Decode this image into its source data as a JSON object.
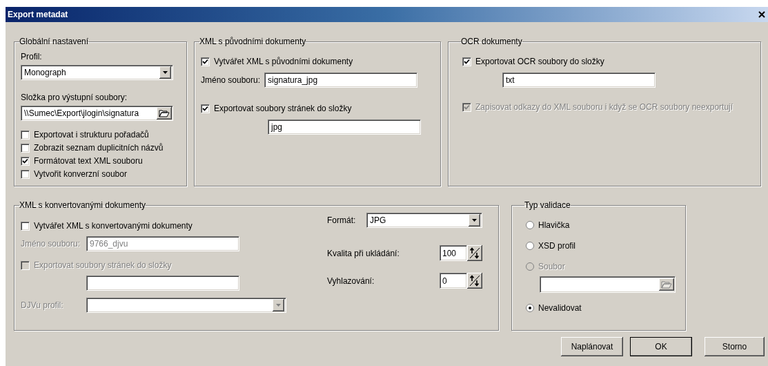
{
  "window": {
    "title": "Export metadat"
  },
  "global_settings": {
    "title": "Globální nastavení",
    "profile_label": "Profil:",
    "profile": {
      "value": "Monograph"
    },
    "folder_label": "Složka pro výstupní soubory:",
    "folder": {
      "value": "\\\\Sumec\\Export\\jlogin\\signatura"
    },
    "options": [
      {
        "label": "Exportovat i strukturu pořadačů",
        "checked": false
      },
      {
        "label": "Zobrazit seznam duplicitních názvů",
        "checked": false
      },
      {
        "label": "Formátovat text XML souboru",
        "checked": true
      },
      {
        "label": "Vytvořit konverzní soubor",
        "checked": false
      }
    ]
  },
  "original_xml": {
    "title": "XML s původními dokumenty",
    "create": {
      "label": "Vytvářet XML s původními dokumenty",
      "checked": true
    },
    "filename_label": "Jméno souboru:",
    "filename": {
      "value": "signatura_jpg"
    },
    "export_pages": {
      "label": "Exportovat soubory stránek do složky",
      "checked": true
    },
    "pages_folder": {
      "value": "jpg"
    }
  },
  "ocr": {
    "title": "OCR dokumenty",
    "export": {
      "label": "Exportovat OCR soubory do složky",
      "checked": true
    },
    "folder": {
      "value": "txt"
    },
    "write_links": {
      "label": "Zapisovat odkazy do XML souboru i když se OCR soubory neexportují",
      "checked": true,
      "disabled": true
    }
  },
  "converted_xml": {
    "title": "XML s konvertovanými dokumenty",
    "create": {
      "label": "Vytvářet XML s konvertovanými dokumenty",
      "checked": false
    },
    "filename_label": "Jméno souboru:",
    "filename": {
      "value": "9766_djvu",
      "disabled": true
    },
    "export_pages": {
      "label": "Exportovat soubory stránek do složky",
      "checked": false,
      "disabled": true
    },
    "djvu_label": "DJVu profil:",
    "djvu_profile": {
      "disabled": true
    },
    "format_label": "Formát:",
    "format": {
      "value": "JPG"
    },
    "quality_label": "Kvalita při ukládání:",
    "quality": {
      "value": "100"
    },
    "smoothing_label": "Vyhlazování:",
    "smoothing": {
      "value": "0"
    }
  },
  "validation": {
    "title": "Typ validace",
    "options": [
      {
        "label": "Hlavička",
        "selected": false,
        "disabled": false
      },
      {
        "label": "XSD profil",
        "selected": false,
        "disabled": false
      },
      {
        "label": "Soubor",
        "selected": false,
        "disabled": true
      },
      {
        "label": "Nevalidovat",
        "selected": true,
        "disabled": false
      }
    ],
    "file_field": {
      "disabled": true
    }
  },
  "buttons": [
    {
      "label": "Naplánovat",
      "default": false
    },
    {
      "label": "OK",
      "default": true
    },
    {
      "label": "Storno",
      "default": false
    }
  ]
}
